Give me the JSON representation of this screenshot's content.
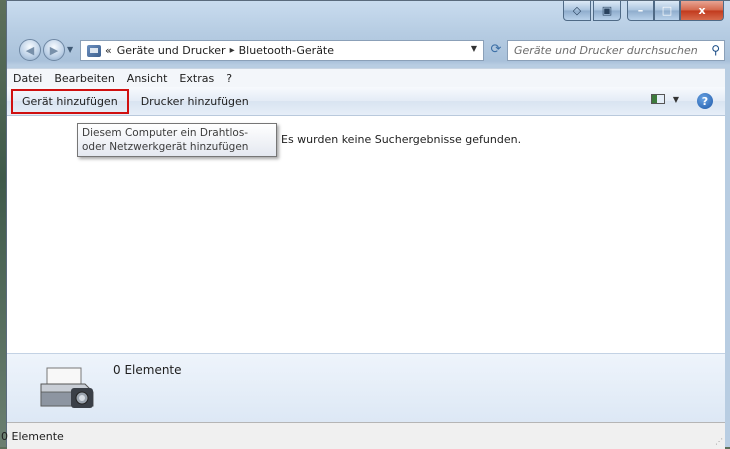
{
  "window": {
    "caption_buttons": {
      "minimize": "–",
      "maximize": "□",
      "close": "x"
    }
  },
  "nav": {
    "back_glyph": "◀",
    "forward_glyph": "▶",
    "breadcrumb_overflow": "«",
    "breadcrumb": [
      "Geräte und Drucker",
      "Bluetooth-Geräte"
    ],
    "breadcrumb_separator": "▸",
    "refresh_glyph": "⟳",
    "search_placeholder": "Geräte und Drucker durchsuchen"
  },
  "menu": [
    "Datei",
    "Bearbeiten",
    "Ansicht",
    "Extras",
    "?"
  ],
  "commands": {
    "add_device": "Gerät hinzufügen",
    "add_printer": "Drucker hinzufügen",
    "help": "?"
  },
  "content": {
    "no_results": "Es wurden keine Suchergebnisse gefunden.",
    "tooltip": "Diesem Computer ein Drahtlos- oder Netzwerkgerät hinzufügen"
  },
  "details": {
    "count": "0 Elemente"
  },
  "status": {
    "text": "0 Elemente"
  },
  "colors": {
    "highlight": "#d01010",
    "accent": "#1d58a8"
  }
}
